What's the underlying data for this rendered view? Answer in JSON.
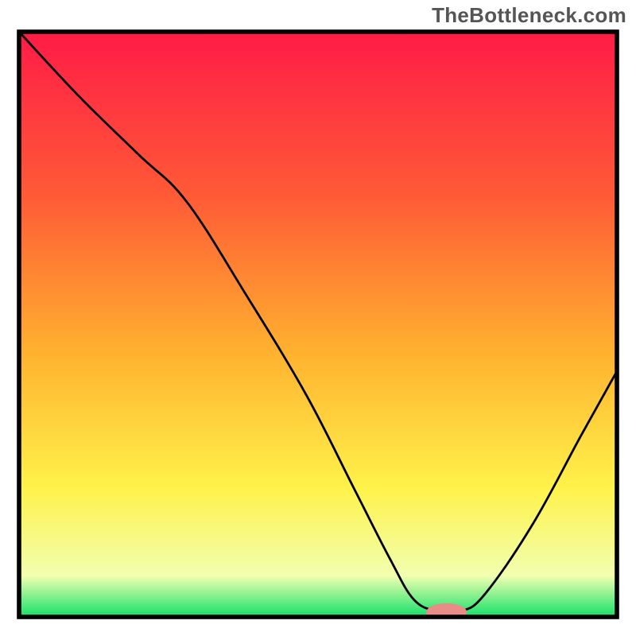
{
  "watermark": "TheBottleneck.com",
  "chart_data": {
    "type": "line",
    "title": "",
    "xlabel": "",
    "ylabel": "",
    "xlim": [
      0,
      100
    ],
    "ylim": [
      0,
      100
    ],
    "grid": false,
    "legend": false,
    "background_gradient": {
      "stops": [
        {
          "offset": 0.0,
          "color": "#ff1b47"
        },
        {
          "offset": 0.28,
          "color": "#ff5a36"
        },
        {
          "offset": 0.55,
          "color": "#ffb22f"
        },
        {
          "offset": 0.78,
          "color": "#fff24a"
        },
        {
          "offset": 0.93,
          "color": "#f1ffb0"
        },
        {
          "offset": 1.0,
          "color": "#15e06a"
        }
      ]
    },
    "series": [
      {
        "name": "bottleneck-curve",
        "color": "#000000",
        "x": [
          0,
          10,
          20,
          28,
          38,
          48,
          56,
          62,
          66,
          70,
          74,
          78,
          86,
          94,
          100
        ],
        "values": [
          100,
          89,
          79,
          71,
          55,
          38,
          22,
          10,
          3,
          1,
          1,
          4,
          16,
          31,
          42
        ]
      }
    ],
    "marker": {
      "name": "target-marker",
      "x": 71.5,
      "y": 0.8,
      "color": "#e98b86",
      "rx": 3.2,
      "ry": 1.4
    },
    "frame": {
      "x": 3.0,
      "y": 5.0,
      "width": 94.0,
      "height": 92.0,
      "stroke": "#000000",
      "stroke_width": 0.7
    }
  }
}
